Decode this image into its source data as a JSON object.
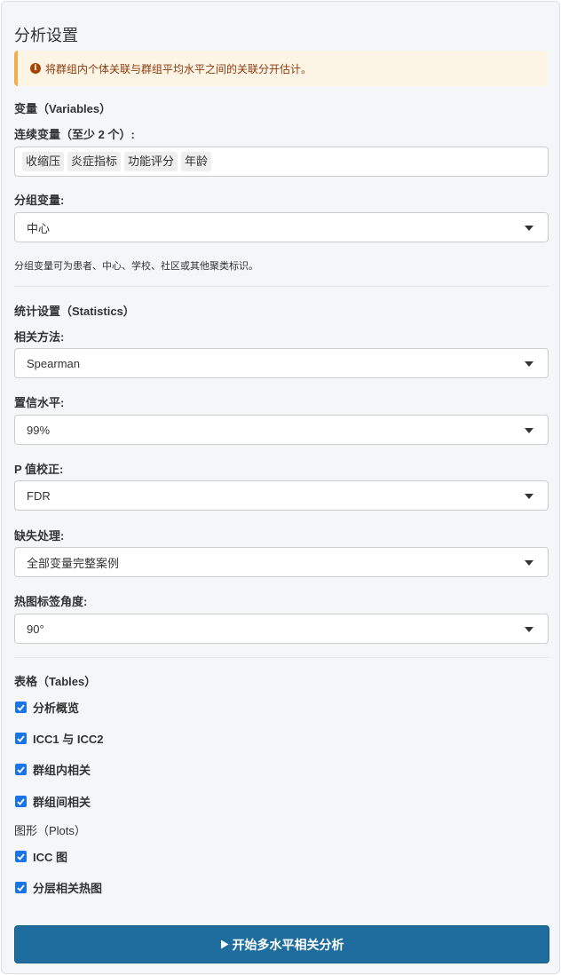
{
  "panel": {
    "title": "分析设置",
    "alert_text": "将群组内个体关联与群组平均水平之间的关联分开估计。",
    "variables_section": "变量（Variables）",
    "continuous_label": "连续变量（至少 2 个）:",
    "continuous_tags": [
      "收缩压",
      "炎症指标",
      "功能评分",
      "年龄"
    ],
    "group_label": "分组变量:",
    "group_value": "中心",
    "group_help": "分组变量可为患者、中心、学校、社区或其他聚类标识。",
    "stats_section": "统计设置（Statistics）",
    "method_label": "相关方法:",
    "method_value": "Spearman",
    "conf_label": "置信水平:",
    "conf_value": "99%",
    "padj_label": "P 值校正:",
    "padj_value": "FDR",
    "missing_label": "缺失处理:",
    "missing_value": "全部变量完整案例",
    "angle_label": "热图标签角度:",
    "angle_value": "90°",
    "tables_section": "表格（Tables）",
    "tables": [
      "分析概览",
      "ICC1 与 ICC2",
      "群组内相关",
      "群组间相关"
    ],
    "plots_section": "图形（Plots）",
    "plots": [
      "ICC 图",
      "分层相关热图"
    ],
    "run_button": "开始多水平相关分析"
  },
  "colors": {
    "accent": "#1a73e8",
    "button": "#1f6d9e",
    "alert_bg": "#fcf4e4",
    "alert_border": "#f0ad4e"
  }
}
